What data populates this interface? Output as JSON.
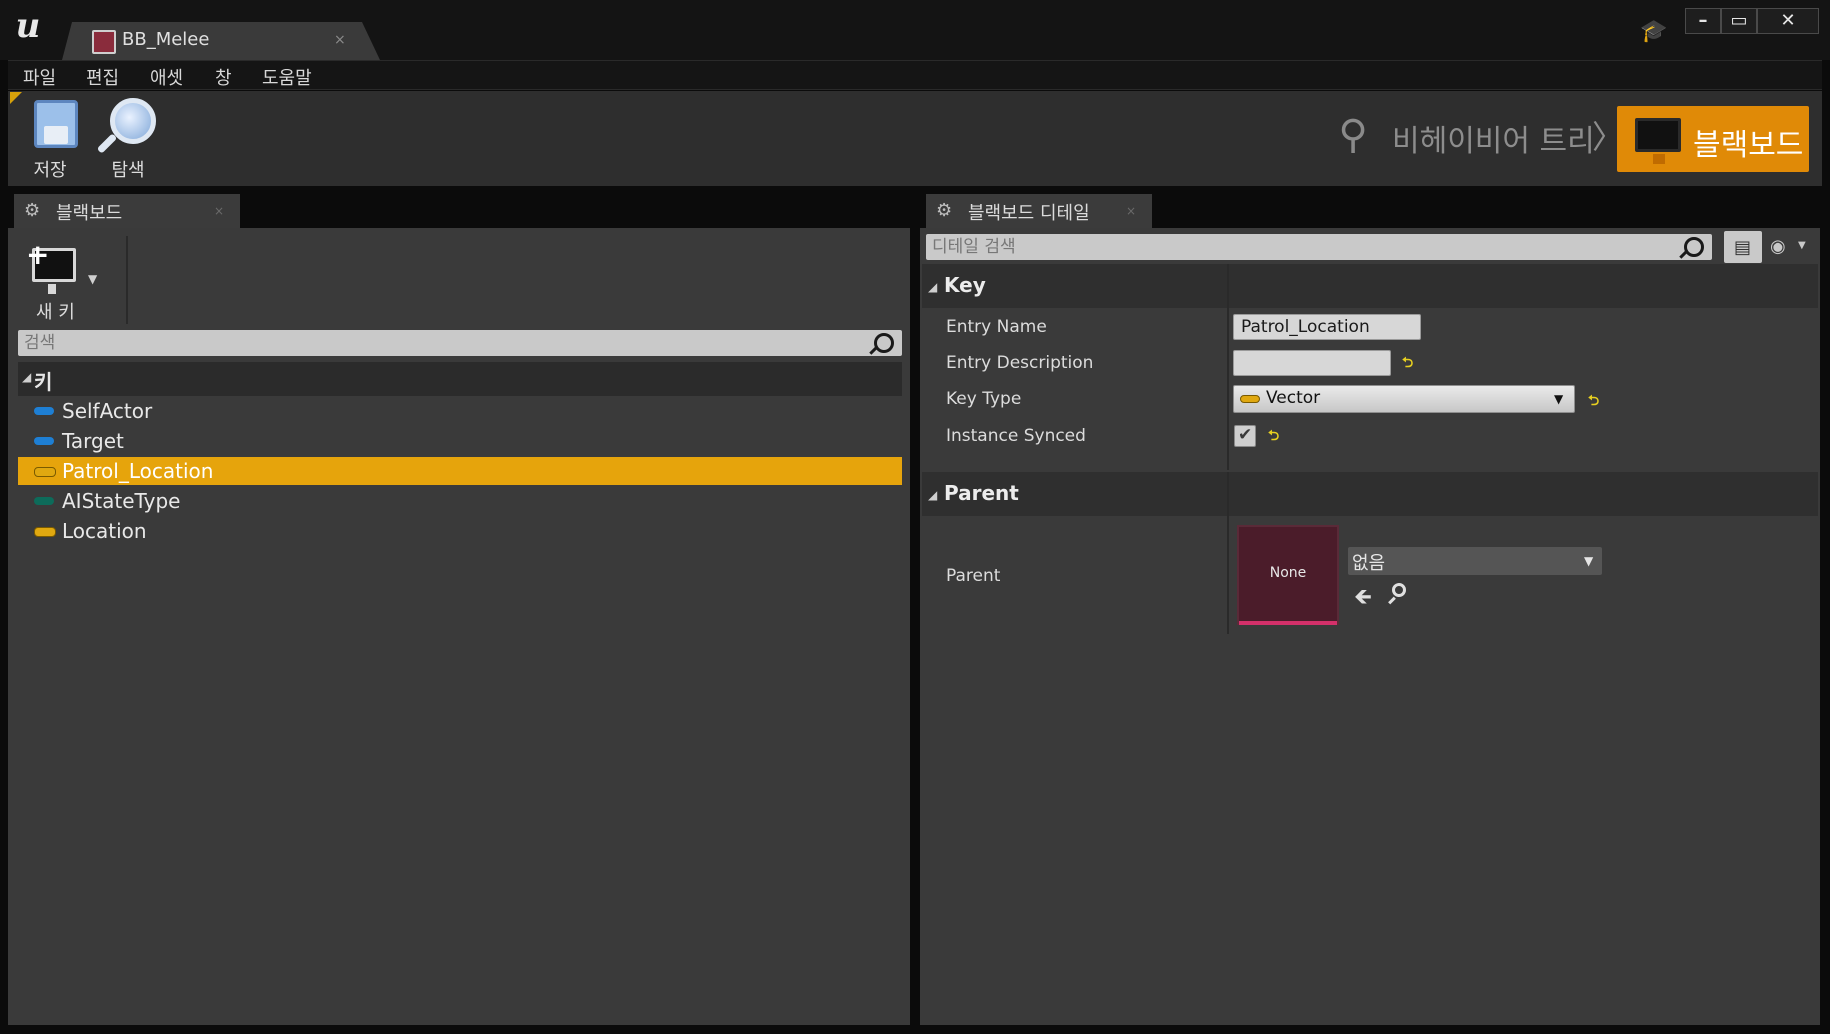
{
  "window": {
    "tab_title": "BB_Melee",
    "tab_close": "×",
    "min": "–",
    "max": "▭",
    "close": "✕"
  },
  "menu": {
    "items": [
      {
        "label": "파일"
      },
      {
        "label": "편집"
      },
      {
        "label": "애셋"
      },
      {
        "label": "창"
      },
      {
        "label": "도움말"
      }
    ]
  },
  "toolbar": {
    "save_label": "저장",
    "browse_label": "탐색"
  },
  "modes": {
    "behavior_tree_label": "비헤이비어 트리",
    "chevron": "〉",
    "blackboard_label": "블랙보드",
    "active_color": "#e08a07"
  },
  "left_panel": {
    "tab_label": "블랙보드",
    "tab_close": "×",
    "new_key_label": "새 키",
    "search_placeholder": "검색",
    "category_label": "키",
    "keys": [
      {
        "name": "SelfActor",
        "color": "#1e7fd4",
        "selected": false
      },
      {
        "name": "Target",
        "color": "#1e7fd4",
        "selected": false
      },
      {
        "name": "Patrol_Location",
        "color": "#e0a810",
        "selected": true
      },
      {
        "name": "AIStateType",
        "color": "#0d6b5a",
        "selected": false
      },
      {
        "name": "Location",
        "color": "#e0a810",
        "selected": false
      }
    ]
  },
  "right_panel": {
    "tab_label": "블랙보드 디테일",
    "tab_close": "×",
    "search_placeholder": "디테일 검색",
    "key_section": {
      "title": "Key",
      "entry_name_label": "Entry Name",
      "entry_name_value": "Patrol_Location",
      "entry_description_label": "Entry Description",
      "entry_description_value": "",
      "key_type_label": "Key Type",
      "key_type_value": "Vector",
      "instance_synced_label": "Instance Synced",
      "instance_synced_checked": true
    },
    "parent_section": {
      "title": "Parent",
      "parent_label": "Parent",
      "thumbnail_label": "None",
      "combo_value": "없음"
    }
  }
}
